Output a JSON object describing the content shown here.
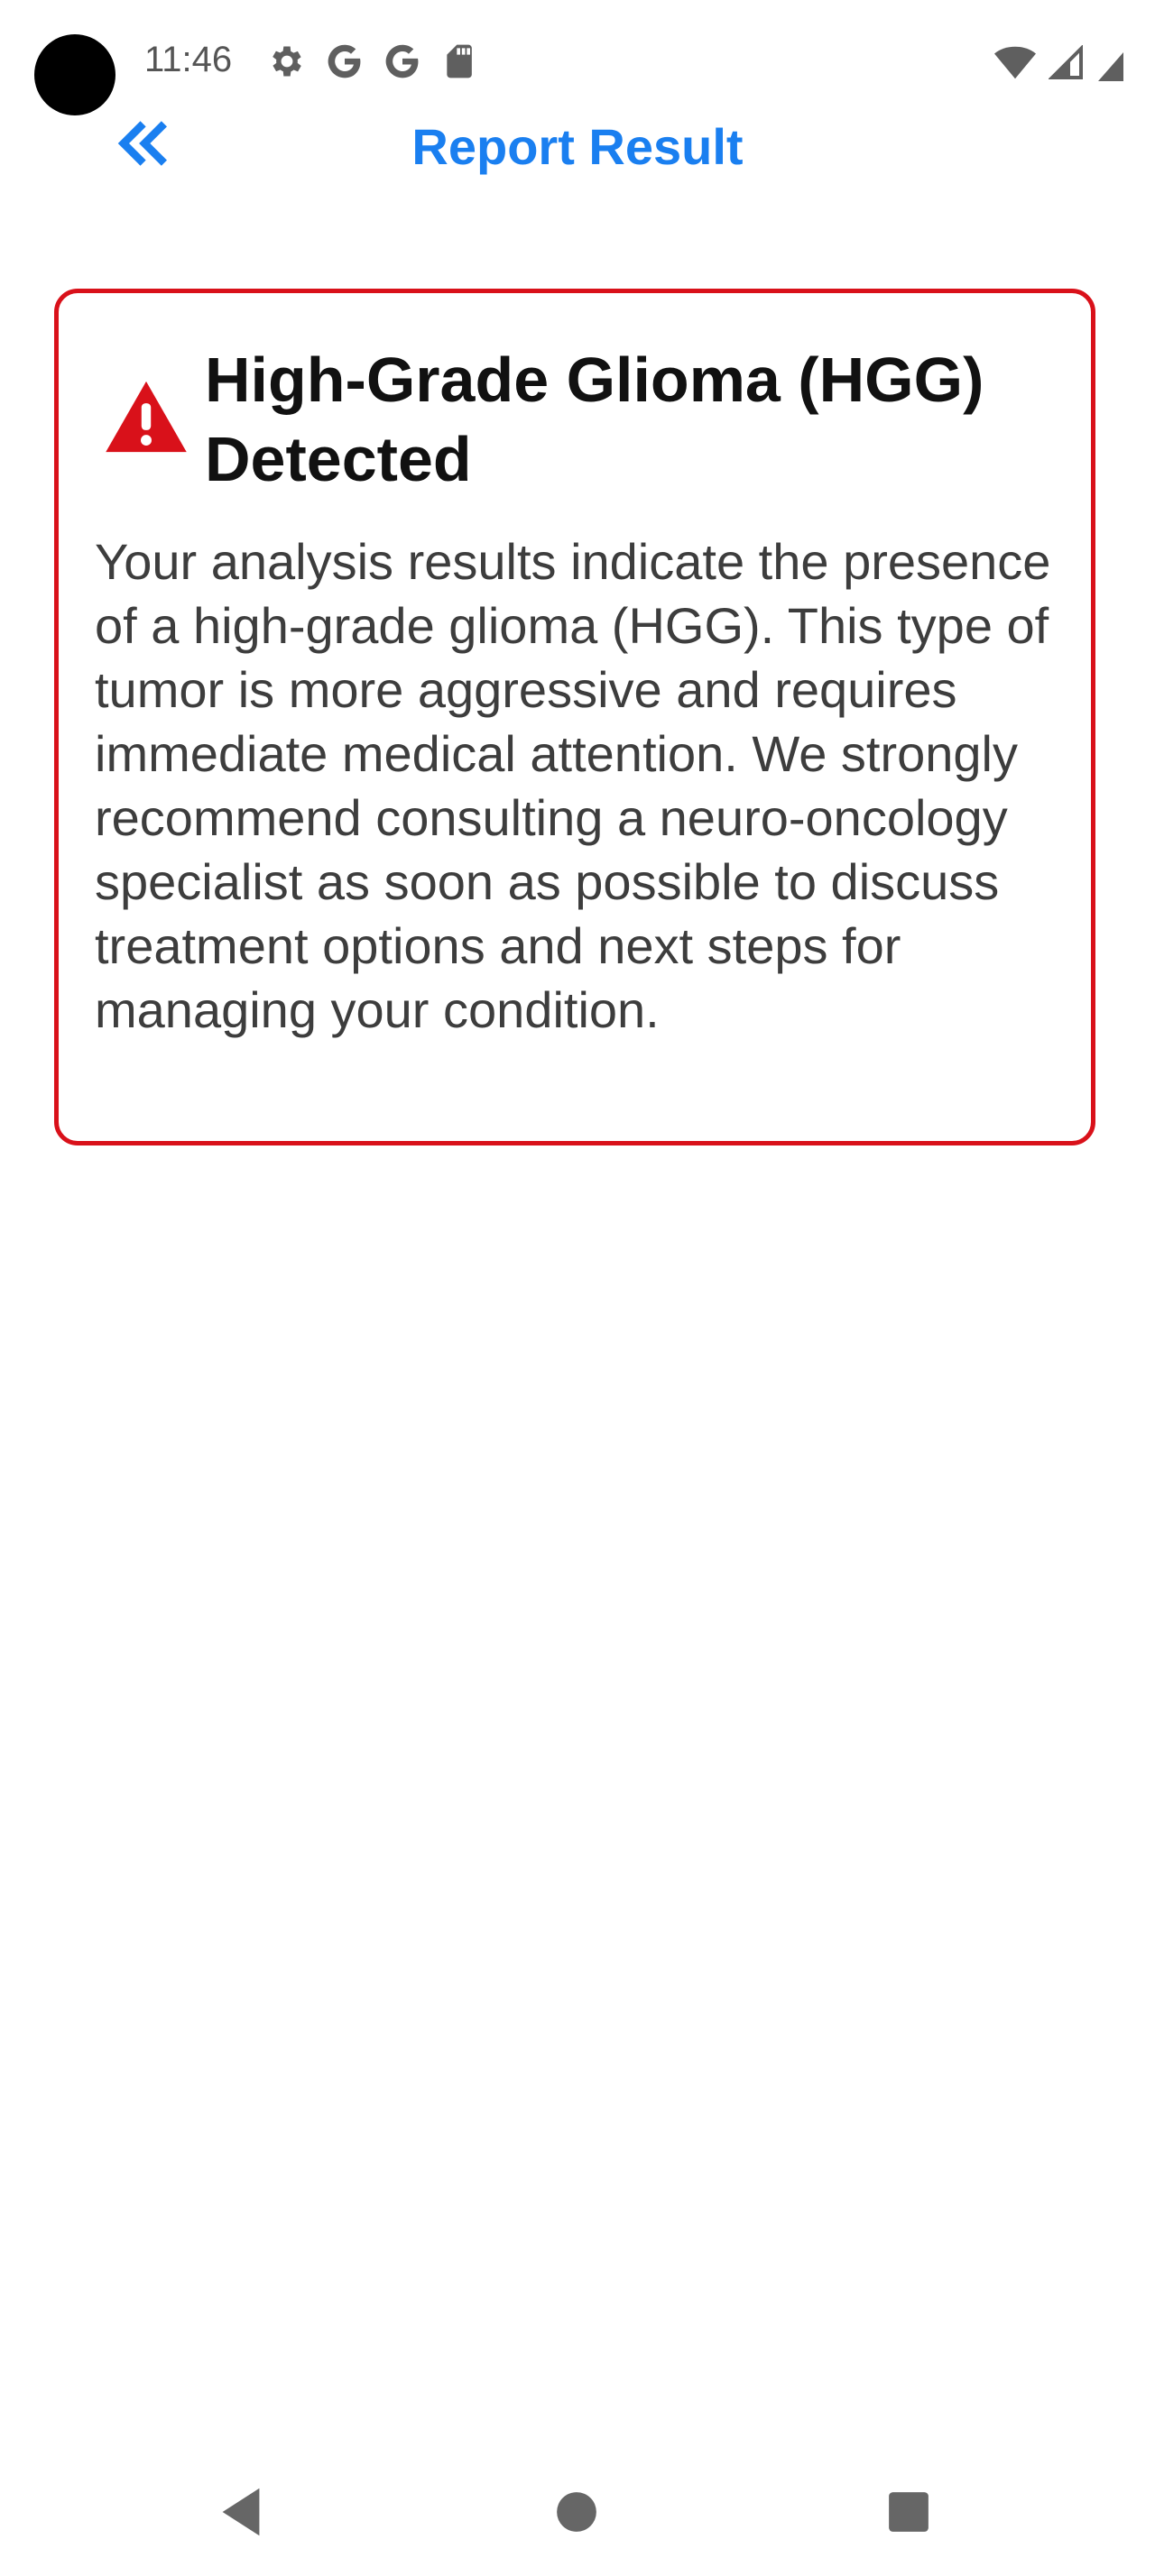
{
  "status_bar": {
    "time": "11:46",
    "icons": [
      "settings-icon",
      "google-icon",
      "google-icon",
      "sd-card-icon"
    ],
    "right_icons": [
      "wifi-icon",
      "signal-icon",
      "battery-icon"
    ]
  },
  "header": {
    "back_icon": "double-chevron-left-icon",
    "title": "Report Result"
  },
  "alert": {
    "icon": "warning-triangle-icon",
    "title": "High-Grade Glioma (HGG) Detected",
    "body": "Your analysis results indicate the presence of a high-grade glioma (HGG). This type of tumor is more aggressive and requires immediate medical attention. We strongly recommend consulting a neuro-oncology specialist as soon as possible to discuss treatment options and next steps for managing your condition.",
    "color": "#d9111a"
  },
  "nav_bar": {
    "buttons": [
      "nav-back-icon",
      "nav-home-icon",
      "nav-recents-icon"
    ]
  },
  "colors": {
    "accent": "#1a7ff0",
    "alert_red": "#d9111a",
    "text_dark": "#111111",
    "text_body": "#3d3d3d"
  }
}
